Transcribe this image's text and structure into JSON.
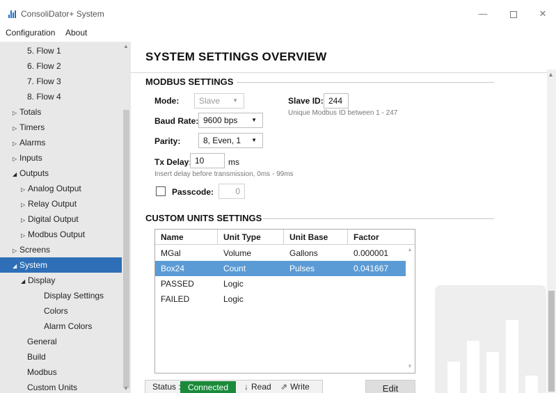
{
  "window": {
    "title": "ConsoliDator+ System",
    "controls": {
      "minimize": "—",
      "close": "✕"
    }
  },
  "menu": [
    "Configuration",
    "About"
  ],
  "sidebar": {
    "items": [
      {
        "label": "5. Flow 1",
        "indent": 3,
        "arrow": ""
      },
      {
        "label": "6. Flow 2",
        "indent": 3,
        "arrow": ""
      },
      {
        "label": "7. Flow 3",
        "indent": 3,
        "arrow": ""
      },
      {
        "label": "8. Flow 4",
        "indent": 3,
        "arrow": ""
      },
      {
        "label": "Totals",
        "indent": 0,
        "arrow": "▷"
      },
      {
        "label": "Timers",
        "indent": 0,
        "arrow": "▷"
      },
      {
        "label": "Alarms",
        "indent": 0,
        "arrow": "▷"
      },
      {
        "label": "Inputs",
        "indent": 0,
        "arrow": "▷"
      },
      {
        "label": "Outputs",
        "indent": 0,
        "arrow": "◢"
      },
      {
        "label": "Analog Output",
        "indent": 1,
        "arrow": "▷"
      },
      {
        "label": "Relay Output",
        "indent": 1,
        "arrow": "▷"
      },
      {
        "label": "Digital Output",
        "indent": 1,
        "arrow": "▷"
      },
      {
        "label": "Modbus Output",
        "indent": 1,
        "arrow": "▷"
      },
      {
        "label": "Screens",
        "indent": 0,
        "arrow": "▷"
      },
      {
        "label": "System",
        "indent": 0,
        "arrow": "◢",
        "selected": true
      },
      {
        "label": "Display",
        "indent": 1,
        "arrow": "◢"
      },
      {
        "label": "Display Settings",
        "indent": 4,
        "arrow": ""
      },
      {
        "label": "Colors",
        "indent": 4,
        "arrow": ""
      },
      {
        "label": "Alarm Colors",
        "indent": 4,
        "arrow": ""
      },
      {
        "label": "General",
        "indent": 3,
        "arrow": ""
      },
      {
        "label": "Build",
        "indent": 3,
        "arrow": ""
      },
      {
        "label": "Modbus",
        "indent": 3,
        "arrow": ""
      },
      {
        "label": "Custom Units",
        "indent": 3,
        "arrow": ""
      }
    ]
  },
  "main": {
    "title": "SYSTEM SETTINGS OVERVIEW",
    "modbus": {
      "heading": "MODBUS SETTINGS",
      "mode_label": "Mode:",
      "mode_value": "Slave",
      "slave_id_label": "Slave ID:",
      "slave_id_value": "244",
      "slave_id_hint": "Unique Modbus ID between 1 - 247",
      "baud_label": "Baud Rate:",
      "baud_value": "9600 bps",
      "parity_label": "Parity:",
      "parity_value": "8, Even, 1",
      "tx_label": "Tx Delay:",
      "tx_value": "10",
      "tx_unit": "ms",
      "tx_hint": "Insert delay before transmission, 0ms - 99ms",
      "passcode_label": "Passcode:",
      "passcode_value": "0",
      "passcode_checked": false
    },
    "custom_units": {
      "heading": "CUSTOM UNITS SETTINGS",
      "columns": [
        "Name",
        "Unit Type",
        "Unit Base",
        "Factor"
      ],
      "rows": [
        {
          "name": "MGal",
          "type": "Volume",
          "base": "Gallons",
          "factor": "0.000001",
          "selected": false
        },
        {
          "name": "Box24",
          "type": "Count",
          "base": "Pulses",
          "factor": "0.041667",
          "selected": true
        },
        {
          "name": "PASSED",
          "type": "Logic",
          "base": "",
          "factor": "",
          "selected": false
        },
        {
          "name": "FAILED",
          "type": "Logic",
          "base": "",
          "factor": "",
          "selected": false
        }
      ]
    },
    "status": {
      "label": "Status :",
      "value": "Connected",
      "value_color": "#1a8a3a",
      "read_label": "Read",
      "write_label": "Write"
    },
    "edit_label": "Edit"
  },
  "colors": {
    "accent": "#2e6fb7",
    "selected_row": "#5b9bd5",
    "connected": "#1a8a3a"
  }
}
